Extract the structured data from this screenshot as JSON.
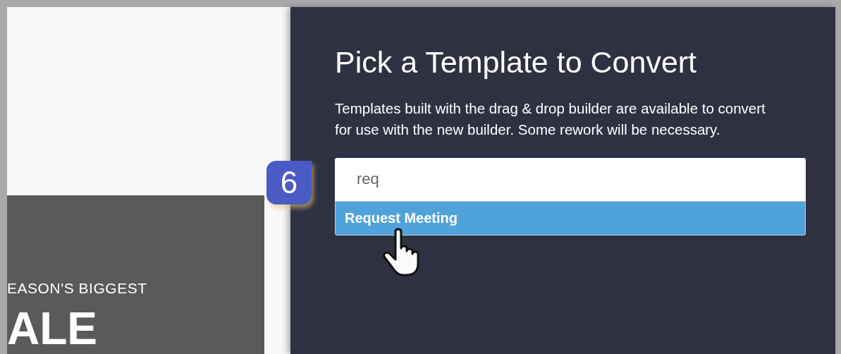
{
  "template_preview": {
    "subtitle": "EASON'S BIGGEST",
    "headline": "ALE"
  },
  "dialog": {
    "title": "Pick a Template to Convert",
    "description": "Templates built with the drag & drop builder are available to convert for use with the new builder. Some rework will be necessary.",
    "search": {
      "value": "req"
    },
    "results": [
      {
        "label": "Request Meeting",
        "selected": true
      }
    ]
  },
  "step_badge": "6"
}
